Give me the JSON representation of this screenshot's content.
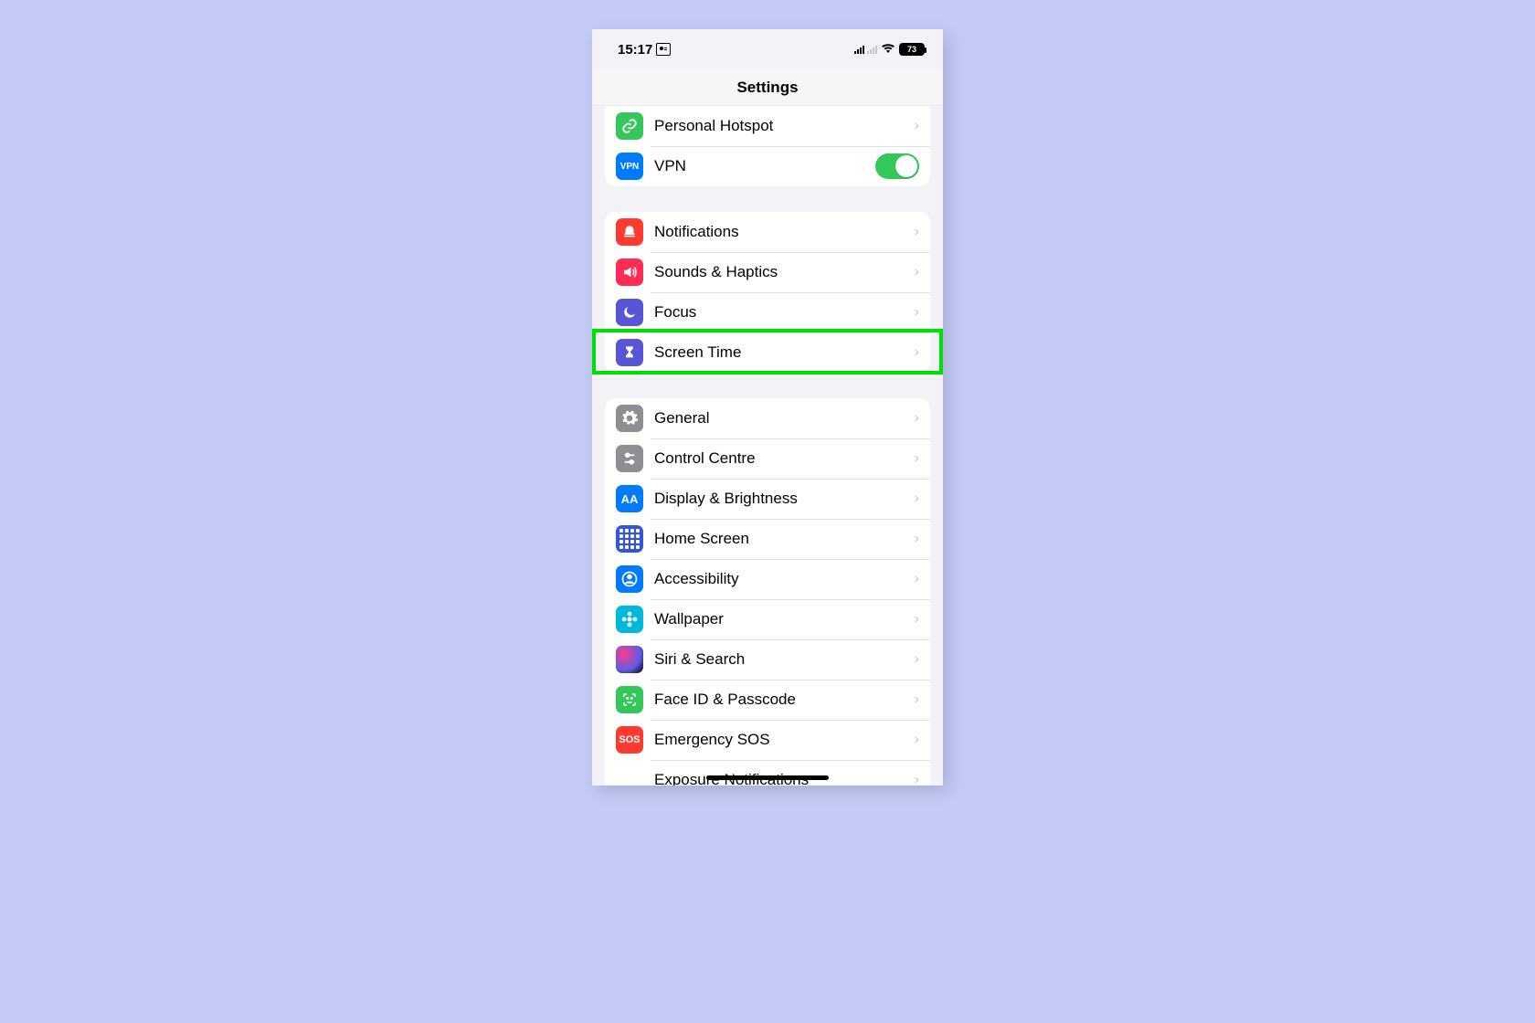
{
  "status": {
    "time": "15:17",
    "battery": "73"
  },
  "header": {
    "title": "Settings"
  },
  "group1": {
    "items": [
      {
        "label": "Personal Hotspot",
        "icon_bg": "#34c759",
        "kind": "chevron",
        "name": "personal-hotspot",
        "glyph": "link"
      },
      {
        "label": "VPN",
        "icon_bg": "#007aff",
        "kind": "toggle",
        "name": "vpn",
        "glyph": "vpn"
      }
    ]
  },
  "group2": {
    "items": [
      {
        "label": "Notifications",
        "icon_bg": "#ff3b30",
        "name": "notifications",
        "glyph": "bell"
      },
      {
        "label": "Sounds & Haptics",
        "icon_bg": "#ff2d55",
        "name": "sounds-haptics",
        "glyph": "speaker"
      },
      {
        "label": "Focus",
        "icon_bg": "#5856d6",
        "name": "focus",
        "glyph": "moon"
      },
      {
        "label": "Screen Time",
        "icon_bg": "#5856d6",
        "name": "screen-time",
        "glyph": "hourglass"
      }
    ]
  },
  "group3": {
    "items": [
      {
        "label": "General",
        "icon_bg": "#8e8e93",
        "name": "general",
        "glyph": "gear"
      },
      {
        "label": "Control Centre",
        "icon_bg": "#8e8e93",
        "name": "control-centre",
        "glyph": "sliders"
      },
      {
        "label": "Display & Brightness",
        "icon_bg": "#007aff",
        "name": "display-brightness",
        "glyph": "aa"
      },
      {
        "label": "Home Screen",
        "icon_bg": "#3355dd",
        "name": "home-screen",
        "glyph": "grid"
      },
      {
        "label": "Accessibility",
        "icon_bg": "#007aff",
        "name": "accessibility",
        "glyph": "person"
      },
      {
        "label": "Wallpaper",
        "icon_bg": "#00b8d9",
        "name": "wallpaper",
        "glyph": "flower"
      },
      {
        "label": "Siri & Search",
        "icon_bg": "siri",
        "name": "siri-search",
        "glyph": "siri"
      },
      {
        "label": "Face ID & Passcode",
        "icon_bg": "#34c759",
        "name": "faceid-passcode",
        "glyph": "face"
      },
      {
        "label": "Emergency SOS",
        "icon_bg": "#ff3b30",
        "name": "emergency-sos",
        "glyph": "sos"
      },
      {
        "label": "Exposure Notifications",
        "icon_bg": "#ffffff",
        "name": "exposure-notifications",
        "glyph": "exposure"
      }
    ]
  },
  "highlight": {
    "target": "screen-time"
  }
}
